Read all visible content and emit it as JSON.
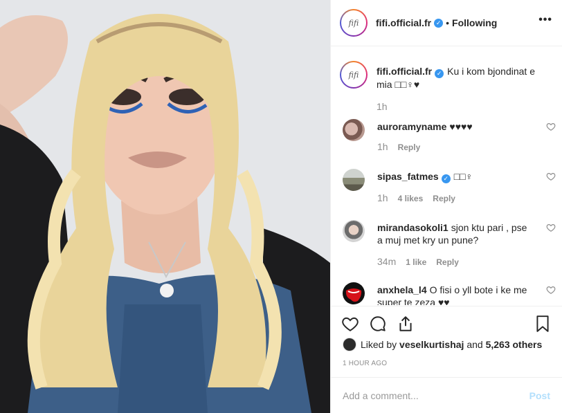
{
  "post": {
    "username": "fifi.official.fr",
    "follow_status": "Following",
    "separator": "•",
    "avatar_text": "fifi",
    "more_label": "•••"
  },
  "caption": {
    "username": "fifi.official.fr",
    "text": "Ku i kom bjondinat e mia □□♀♥",
    "time": "1h"
  },
  "comments": [
    {
      "username": "auroramyname",
      "text": "♥♥♥♥",
      "time": "1h",
      "likes": "",
      "reply": "Reply",
      "verified": false
    },
    {
      "username": "sipas_fatmes",
      "text": "□□♀",
      "time": "1h",
      "likes": "4 likes",
      "reply": "Reply",
      "verified": true
    },
    {
      "username": "mirandasokoli1",
      "text": "sjon ktu pari , pse a muj met kry un pune?",
      "time": "34m",
      "likes": "1 like",
      "reply": "Reply",
      "verified": false
    },
    {
      "username": "anxhela_l4",
      "text": "O fisi o yll bote i ke me super te zeza ♥♥",
      "time": "",
      "likes": "",
      "reply": "",
      "verified": false
    }
  ],
  "likes_summary": {
    "prefix": "Liked by",
    "user": "veselkurtishaj",
    "middle": "and",
    "count": "5,263 others"
  },
  "timestamp": "1 HOUR AGO",
  "add_comment": {
    "placeholder": "Add a comment...",
    "post_label": "Post"
  },
  "colors": {
    "accent": "#3897f0",
    "muted": "#8e8e8e",
    "post_disabled": "#b2dffc"
  }
}
